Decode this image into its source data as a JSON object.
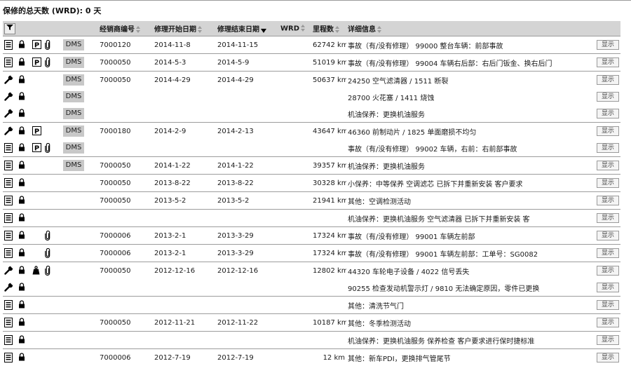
{
  "summary": {
    "label": "保修的总天数 (WRD):",
    "value": "0 天"
  },
  "header": {
    "dealer": "经销商编号",
    "start": "修理开始日期",
    "end": "修理结束日期",
    "wrd": "WRD",
    "mileage": "里程数",
    "details": "详细信息"
  },
  "button_label": "显示",
  "dms_label": "DMS",
  "rows": [
    {
      "sep": true,
      "icon": "doc",
      "lock": true,
      "p": true,
      "clip": true,
      "dms": true,
      "dealer": "7000120",
      "start": "2014-11-8",
      "end": "2014-11-15",
      "km": "62742 km",
      "details": "事故（有/没有修理） 99000 整台车辆：前部事故"
    },
    {
      "sep": true,
      "icon": "doc",
      "lock": true,
      "p": true,
      "clip": true,
      "dms": true,
      "dealer": "7000050",
      "start": "2014-5-3",
      "end": "2014-5-9",
      "km": "51019 km",
      "details": "事故（有/没有修理） 99004 车辆右后部：右后门钣金、换右后门"
    },
    {
      "sep": true,
      "icon": "wrench",
      "lock": true,
      "p": false,
      "clip": false,
      "dms": true,
      "dealer": "7000050",
      "start": "2014-4-29",
      "end": "2014-4-29",
      "km": "50637 km",
      "details": "24250 空气滤清器 / 1511 断裂"
    },
    {
      "sep": false,
      "icon": "wrench",
      "lock": true,
      "p": false,
      "clip": false,
      "dms": true,
      "dealer": "",
      "start": "",
      "end": "",
      "km": "",
      "details": "28700 火花塞 / 1411 烧蚀"
    },
    {
      "sep": false,
      "icon": "wrench",
      "lock": true,
      "p": false,
      "clip": false,
      "dms": true,
      "dealer": "",
      "start": "",
      "end": "",
      "km": "",
      "details": "机油保养：更换机油服务"
    },
    {
      "sep": true,
      "icon": "wrench",
      "lock": true,
      "p": true,
      "clip": false,
      "dms": true,
      "dealer": "7000180",
      "start": "2014-2-9",
      "end": "2014-2-13",
      "km": "43647 km",
      "details": "46360 前制动片 / 1825 单面磨损不均匀"
    },
    {
      "sep": false,
      "icon": "doc",
      "lock": true,
      "p": true,
      "clip": true,
      "dms": true,
      "dealer": "",
      "start": "",
      "end": "",
      "km": "",
      "details": "事故（有/没有修理） 99002 车辆，右前：右前部事故"
    },
    {
      "sep": true,
      "icon": "doc",
      "lock": true,
      "p": false,
      "clip": false,
      "dms": true,
      "dealer": "7000050",
      "start": "2014-1-22",
      "end": "2014-1-22",
      "km": "39357 km",
      "details": "机油保养：更换机油服务"
    },
    {
      "sep": true,
      "icon": "doc",
      "lock": true,
      "p": false,
      "clip": false,
      "dms": false,
      "dealer": "7000050",
      "start": "2013-8-22",
      "end": "2013-8-22",
      "km": "30328 km",
      "details": "小保养：中等保养 空调滤芯 已拆下并重新安装 客户要求"
    },
    {
      "sep": true,
      "icon": "doc",
      "lock": true,
      "p": false,
      "clip": false,
      "dms": false,
      "dealer": "7000050",
      "start": "2013-5-2",
      "end": "2013-5-2",
      "km": "21941 km",
      "details": "其他：空调检测活动"
    },
    {
      "sep": true,
      "icon": "doc",
      "lock": true,
      "p": false,
      "clip": false,
      "dms": false,
      "dealer": "",
      "start": "",
      "end": "",
      "km": "",
      "details": "机油保养：更换机油服务 空气滤清器 已拆下并重新安装 客"
    },
    {
      "sep": true,
      "icon": "doc",
      "lock": true,
      "p": false,
      "clip": true,
      "dms": false,
      "dealer": "7000006",
      "start": "2013-2-1",
      "end": "2013-3-29",
      "km": "17324 km",
      "details": "事故（有/没有修理） 99001 车辆左前部"
    },
    {
      "sep": true,
      "icon": "doc",
      "lock": true,
      "p": false,
      "clip": true,
      "dms": false,
      "dealer": "7000006",
      "start": "2013-2-1",
      "end": "2013-3-29",
      "km": "17324 km",
      "details": "事故（有/没有修理） 99001 车辆左前部：工单号：SG0082"
    },
    {
      "sep": true,
      "icon": "wrench",
      "lock": true,
      "p": false,
      "clip": true,
      "dms": false,
      "weight": true,
      "dealer": "7000050",
      "start": "2012-12-16",
      "end": "2012-12-16",
      "km": "12802 km",
      "details": "44320 车轮电子设备 / 4022 信号丢失"
    },
    {
      "sep": false,
      "icon": "wrench",
      "lock": true,
      "p": false,
      "clip": false,
      "dms": false,
      "dealer": "",
      "start": "",
      "end": "",
      "km": "",
      "details": "90255 检查发动机警示灯 / 9810 无法确定原因，零件已更换"
    },
    {
      "sep": true,
      "icon": "doc",
      "lock": true,
      "p": false,
      "clip": false,
      "dms": false,
      "dealer": "",
      "start": "",
      "end": "",
      "km": "",
      "details": "其他：清洗节气门"
    },
    {
      "sep": true,
      "icon": "doc",
      "lock": true,
      "p": false,
      "clip": false,
      "dms": false,
      "dealer": "7000050",
      "start": "2012-11-21",
      "end": "2012-11-22",
      "km": "10187 km",
      "details": "其他：冬季检测活动"
    },
    {
      "sep": true,
      "icon": "doc",
      "lock": true,
      "p": false,
      "clip": false,
      "dms": false,
      "dealer": "",
      "start": "",
      "end": "",
      "km": "",
      "details": "机油保养：更换机油服务 保养检查 客户要求进行保时捷标准"
    },
    {
      "sep": true,
      "icon": "doc",
      "lock": true,
      "p": false,
      "clip": false,
      "dms": false,
      "dealer": "7000006",
      "start": "2012-7-19",
      "end": "2012-7-19",
      "km": "12 km",
      "details": "其他：新车PDI，更换排气管尾节"
    }
  ]
}
